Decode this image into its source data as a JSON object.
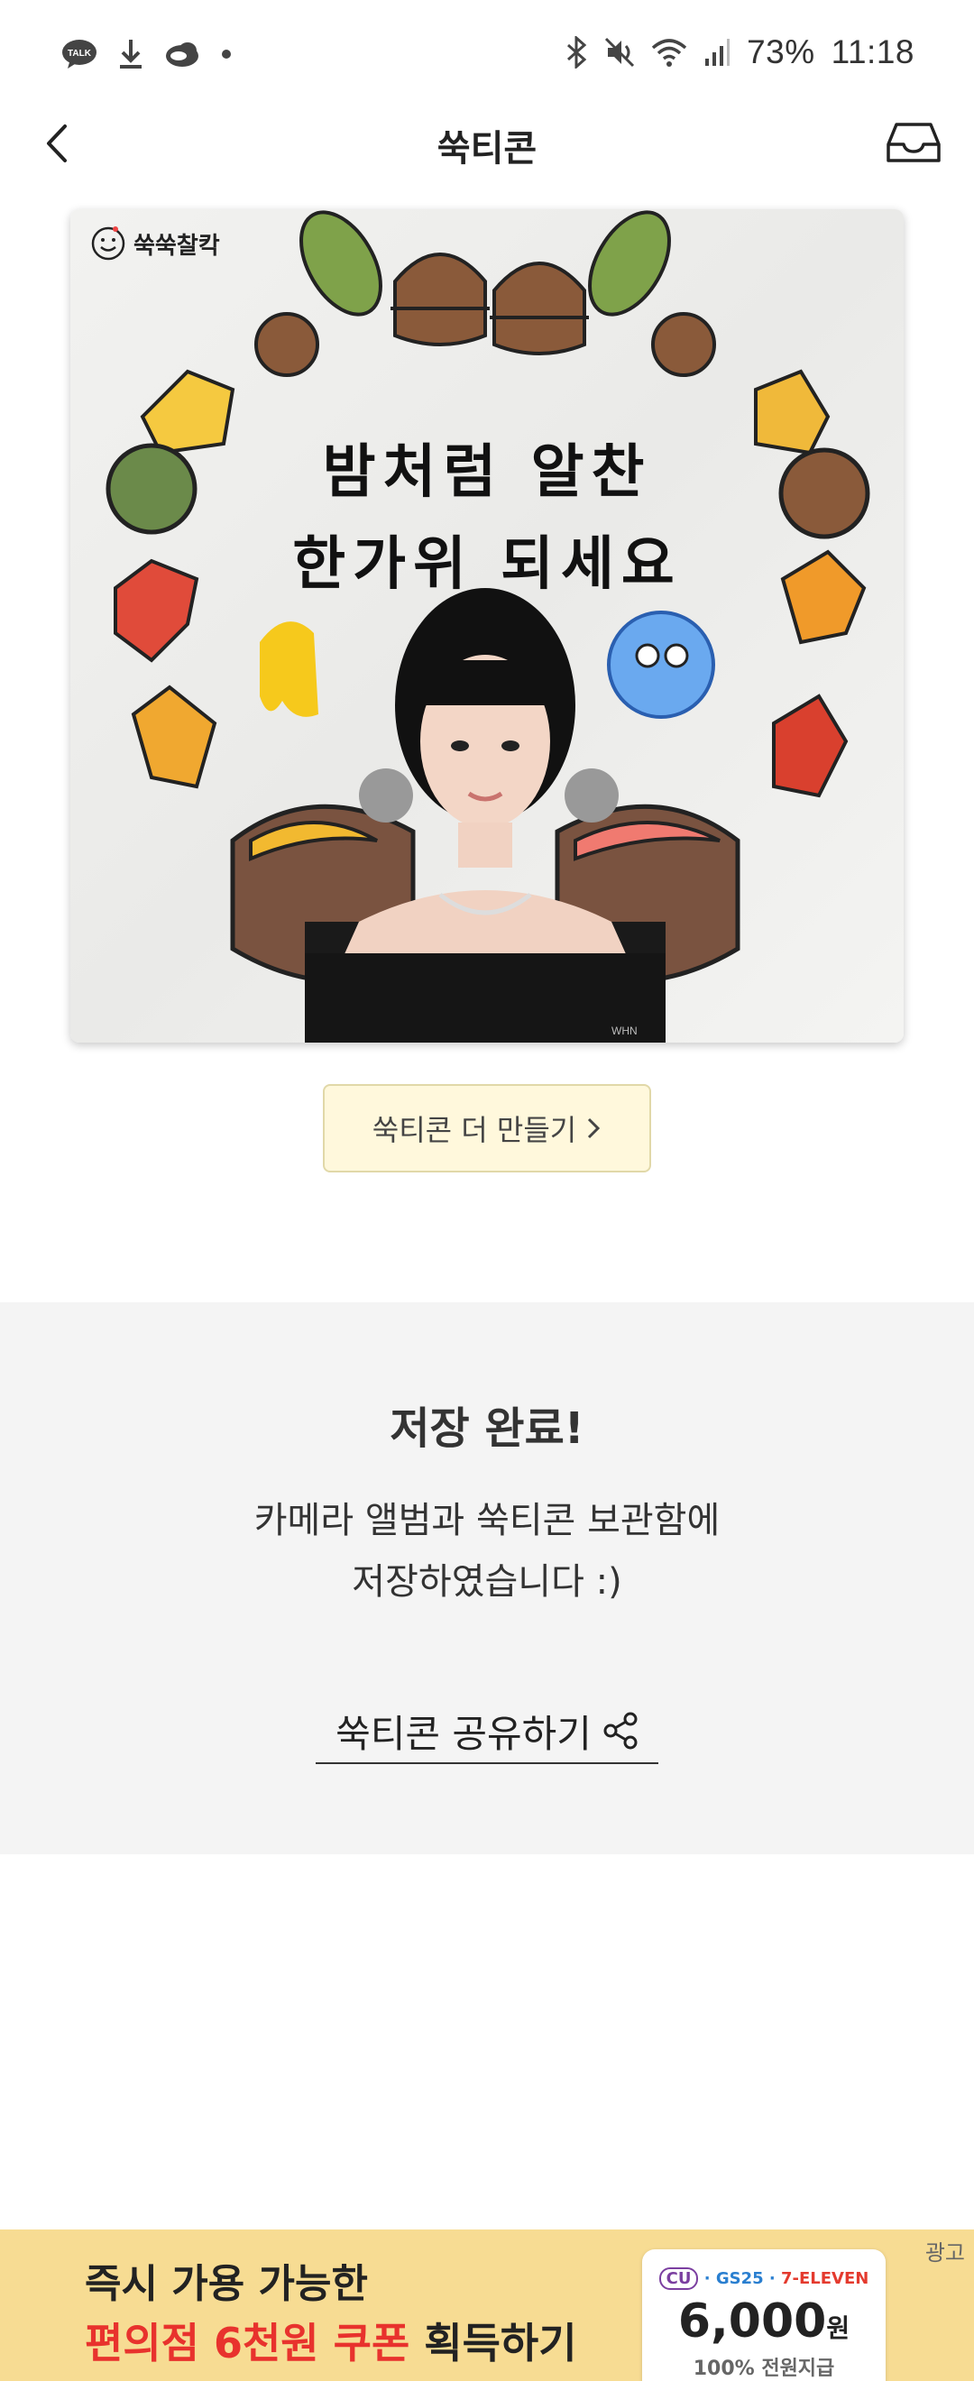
{
  "status_bar": {
    "battery": "73%",
    "time": "11:18",
    "left_icons": [
      "talk-icon",
      "download-icon",
      "cloud-icon",
      "dot-icon"
    ],
    "right_icons": [
      "bluetooth-icon",
      "mute-icon",
      "wifi-icon",
      "signal-icon"
    ]
  },
  "header": {
    "title": "쑥티콘"
  },
  "sticker": {
    "brand": "쑥쑥찰칵",
    "caption_line1": "밤처럼 알찬",
    "caption_line2": "한가위 되세요",
    "watermark": "WHN"
  },
  "more_button": {
    "label": "쑥티콘 더 만들기"
  },
  "saved": {
    "title": "저장 완료!",
    "desc_line1": "카메라 앨범과 쑥티콘 보관함에",
    "desc_line2": "저장하였습니다 :)",
    "share_label": "쑥티콘 공유하기"
  },
  "ad": {
    "tag": "광고",
    "line1": "즉시 가용 가능한",
    "line2_red": "편의점 6천원 쿠폰",
    "line2_dark": " 획득하기",
    "coupon_brand_cu": "CU",
    "coupon_brand_gs": "GS25",
    "coupon_brand_7": "7-ELEVEN",
    "coupon_amount": "6,000",
    "coupon_unit": "원",
    "coupon_sub": "100% 전원지급",
    "colors": {
      "background": "#f7dc93",
      "red": "#e8322d"
    }
  }
}
